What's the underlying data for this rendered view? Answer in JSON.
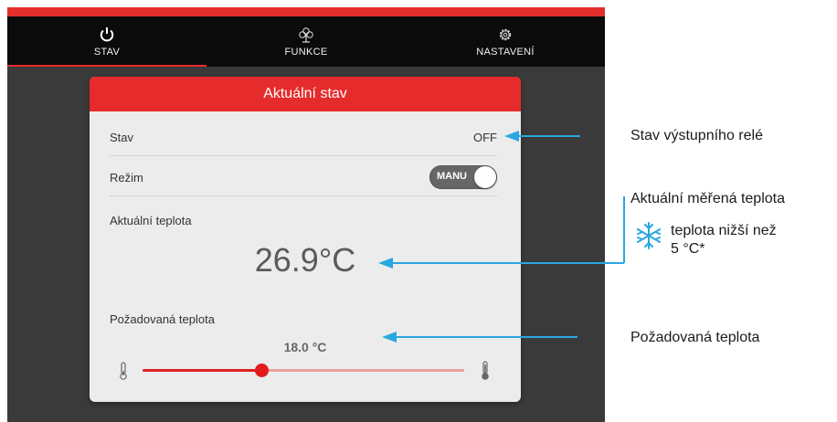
{
  "nav": {
    "tabs": [
      {
        "label": "STAV",
        "icon": "power-icon"
      },
      {
        "label": "FUNKCE",
        "icon": "fan-icon"
      },
      {
        "label": "NASTAVENÍ",
        "icon": "gear-icon"
      }
    ]
  },
  "card": {
    "title": "Aktuální stav",
    "stav_label": "Stav",
    "stav_value": "OFF",
    "rezim_label": "Režim",
    "rezim_value": "MANU",
    "current_temp_label": "Aktuální teplota",
    "current_temp_value": "26.9°C",
    "target_temp_label": "Požadovaná teplota",
    "target_temp_value": "18.0 °C",
    "slider_fraction": 0.37
  },
  "annotations": {
    "relay": "Stav výstupního relé",
    "measured": "Aktuální měřená teplota",
    "below_line1": "teplota nižší než",
    "below_line2": "5 °C*",
    "target": "Požadovaná teplota"
  },
  "colors": {
    "accent": "#e42d2d",
    "arrow": "#29a8df",
    "nav_bg": "#0b0b0b"
  }
}
